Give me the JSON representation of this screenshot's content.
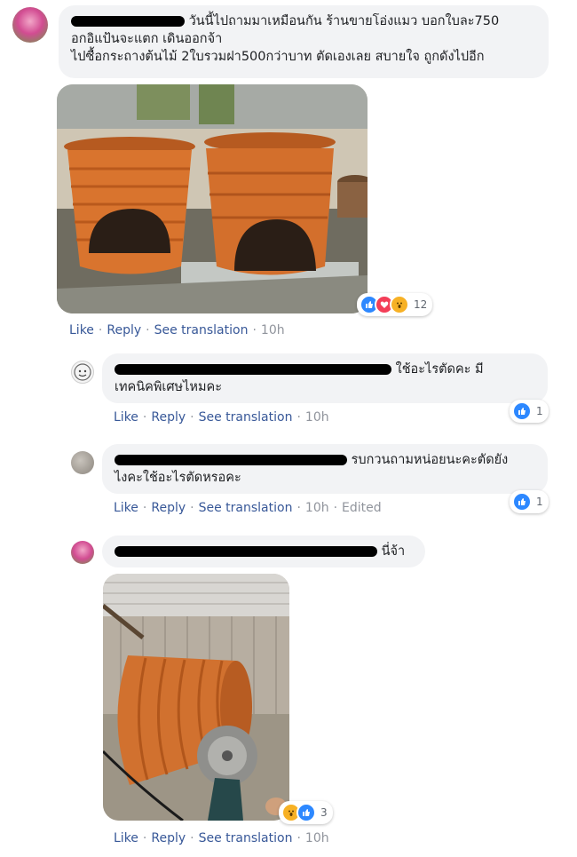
{
  "actions": {
    "like": "Like",
    "reply": "Reply",
    "see_translation": "See translation",
    "sep": "·",
    "edited": "Edited"
  },
  "comment1": {
    "text_line1": "วันนี้ไปถามมาเหมือนกัน ร้านขายโอ่งแมว บอกใบละ750",
    "text_line2": "อกอิแป้นจะแตก เดินออกจ้า",
    "text_line3": "ไปซื้อกระถางต้นไม้ 2ใบรวมฝา500กว่าบาท ตัดเองเลย สบายใจ ถูกดังไปอีก",
    "reactions_count": "12",
    "time": "10h"
  },
  "reply1": {
    "text_line1": "ใช้อะไรตัดคะ มี",
    "text_line2": "เทคนิคพิเศษไหมคะ",
    "reactions_count": "1",
    "time": "10h"
  },
  "reply2": {
    "text_line1": "รบกวนถามหน่อยนะคะตัดยัง",
    "text_line2": "ไงคะใช้อะไรตัดหรอคะ",
    "reactions_count": "1",
    "time": "10h"
  },
  "reply3": {
    "text": "นี่จ้า",
    "reactions_count": "3",
    "time": "10h"
  },
  "colors": {
    "link": "#385898",
    "bubble": "#f2f3f5",
    "like_blue": "#2d88ff",
    "love_red": "#f33e58",
    "wow_yellow": "#f7b125",
    "meta": "#90949c"
  }
}
